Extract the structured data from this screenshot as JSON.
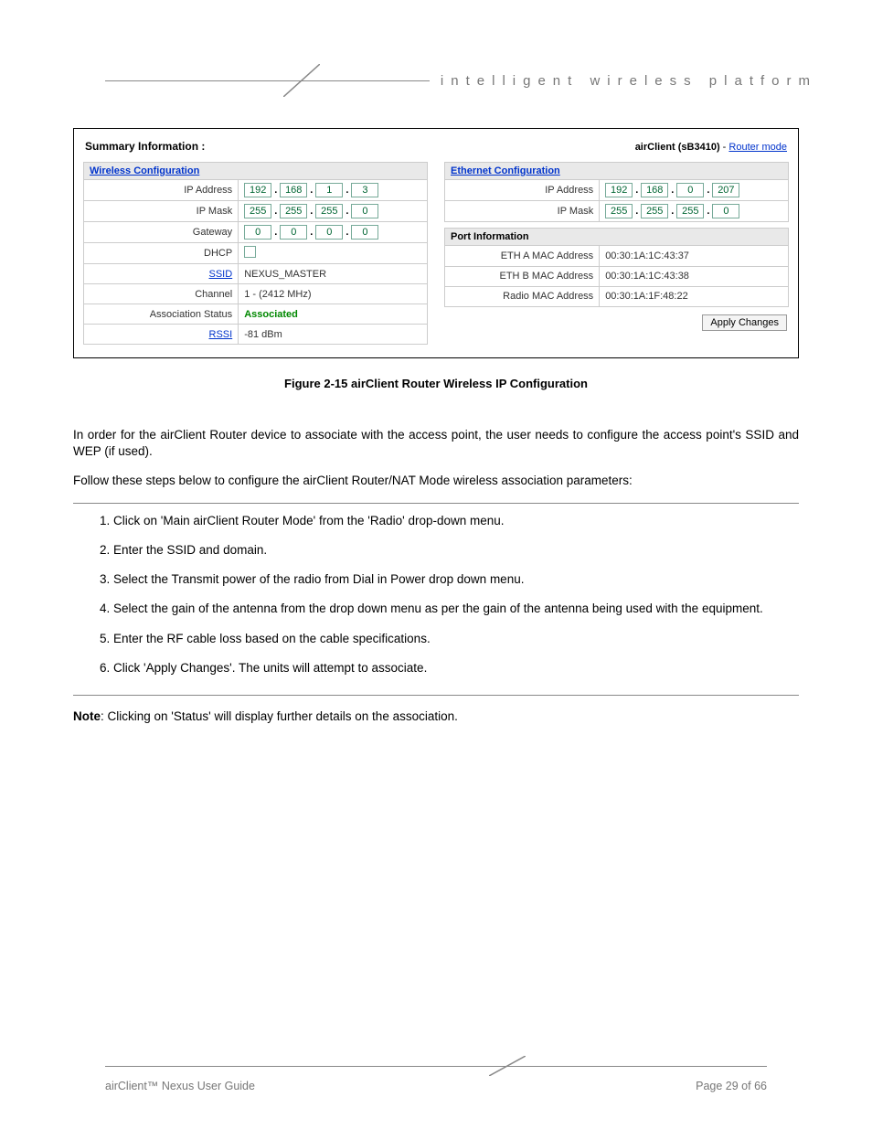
{
  "header": {
    "tagline": "intelligent wireless platform"
  },
  "screenshot": {
    "title": "Summary Information :",
    "device": "airClient (sB3410)",
    "mode_sep": " - ",
    "mode_link": "Router mode",
    "wireless": {
      "heading": "Wireless Configuration",
      "rows": {
        "ip_label": "IP Address",
        "ip": [
          "192",
          "168",
          "1",
          "3"
        ],
        "mask_label": "IP Mask",
        "mask": [
          "255",
          "255",
          "255",
          "0"
        ],
        "gw_label": "Gateway",
        "gw": [
          "0",
          "0",
          "0",
          "0"
        ],
        "dhcp_label": "DHCP",
        "dhcp_checked": false,
        "ssid_label": "SSID",
        "ssid": "NEXUS_MASTER",
        "channel_label": "Channel",
        "channel": "1 - (2412 MHz)",
        "assoc_label": "Association Status",
        "assoc": "Associated",
        "rssi_label": "RSSI",
        "rssi": "-81 dBm"
      }
    },
    "ethernet": {
      "heading": "Ethernet Configuration",
      "rows": {
        "ip_label": "IP Address",
        "ip": [
          "192",
          "168",
          "0",
          "207"
        ],
        "mask_label": "IP Mask",
        "mask": [
          "255",
          "255",
          "255",
          "0"
        ]
      }
    },
    "port": {
      "heading": "Port Information",
      "rows": {
        "ethA_label": "ETH A MAC Address",
        "ethA": "00:30:1A:1C:43:37",
        "ethB_label": "ETH B MAC Address",
        "ethB": "00:30:1A:1C:43:38",
        "radio_label": "Radio MAC Address",
        "radio": "00:30:1A:1F:48:22"
      }
    },
    "apply_label": "Apply Changes"
  },
  "caption": "Figure 2-15 airClient Router Wireless IP Configuration",
  "body": {
    "p1": "In order for the airClient Router device to associate with the access point, the user needs to configure the access point's SSID and WEP (if used).",
    "p2": "Follow these steps below to configure the airClient Router/NAT Mode wireless association parameters:",
    "steps": [
      "Click on 'Main airClient Router Mode' from the 'Radio' drop-down menu.",
      "Enter the SSID and domain.",
      "Select the Transmit power of the radio from Dial in Power drop down menu.",
      "Select the gain of the antenna from the drop down menu as per the gain of the antenna being used with the equipment.",
      "Enter the RF cable loss based on the cable specifications.",
      "Click 'Apply Changes'. The units will attempt to associate."
    ],
    "note_label": "Note",
    "note_sep": ":    ",
    "note_body": "Clicking on 'Status' will display further details on the association."
  },
  "footer": {
    "left": "airClient™ Nexus User Guide",
    "right": "Page 29 of 66"
  }
}
